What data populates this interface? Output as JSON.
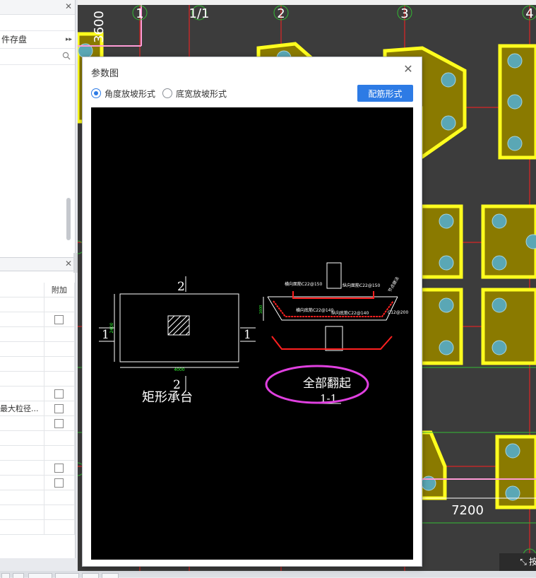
{
  "left_panel": {
    "row_text": "件存盘",
    "search_placeholder": "",
    "column_header": "附加",
    "row_truncated": "最大粒径...",
    "checkbox_rows": [
      3,
      7,
      8,
      9,
      12,
      13
    ]
  },
  "cad": {
    "axis_labels": [
      "1",
      "1/1",
      "2",
      "3",
      "4"
    ],
    "vertical_dim": "3600",
    "dim_7200": "7200",
    "status_text": "按鼠标左键指定插入点",
    "colors": {
      "footing_fill": "#8a7a00",
      "footing_border": "#ffff1e",
      "pile": "#5aa7b5",
      "axis": "#ff2020",
      "bg": "#3c3c3c"
    }
  },
  "dialog": {
    "title": "参数图",
    "radio_angle": "角度放坡形式",
    "radio_width": "底宽放坡形式",
    "selected": "angle",
    "rebar_button": "配筋形式",
    "drawing": {
      "plan_caption": "矩形承台",
      "section_top_label": "2",
      "section_bottom_label": "2",
      "section_left_label": "1",
      "section_right_label": "1",
      "plan_width_dim": "4000",
      "plan_height_dim": "2400",
      "section_caption": "1-1",
      "annotation": "全部翻起",
      "rebar_labels": {
        "top_horizontal": "横向面筋C22@150",
        "top_longitudinal": "纵向面筋C22@150",
        "bottom_horizontal": "横向底筋C22@140",
        "bottom_longitudinal": "纵向底筋C22@140",
        "side": "C12@200",
        "side_vertical": "节点做法",
        "height_dim": "1600"
      }
    }
  }
}
